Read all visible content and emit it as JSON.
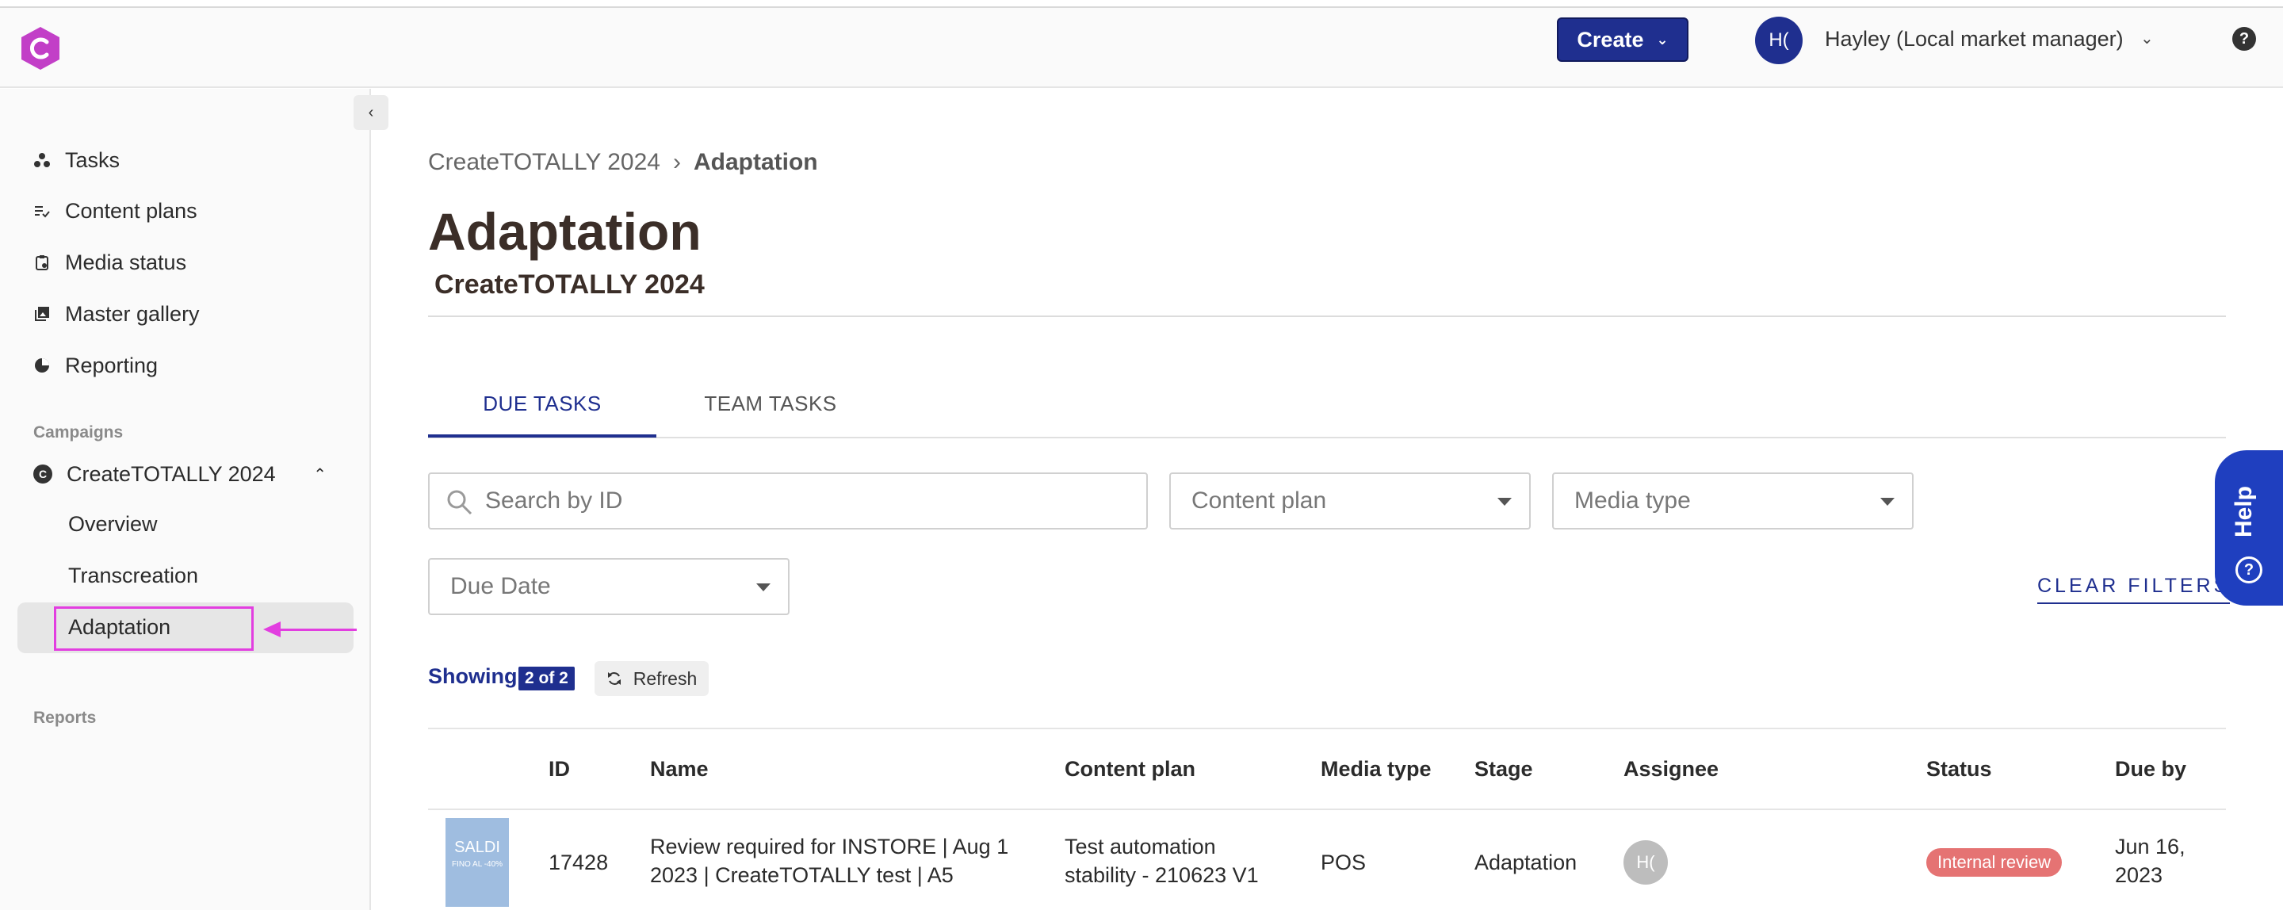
{
  "header": {
    "create_label": "Create",
    "user_initials": "H(",
    "user_name": "Hayley (Local market manager)"
  },
  "sidebar": {
    "items": [
      {
        "label": "Tasks",
        "icon": "tasks-icon"
      },
      {
        "label": "Content plans",
        "icon": "checklist-icon"
      },
      {
        "label": "Media status",
        "icon": "clipboard-icon"
      },
      {
        "label": "Master gallery",
        "icon": "gallery-icon"
      },
      {
        "label": "Reporting",
        "icon": "pie-chart-icon"
      }
    ],
    "campaigns_label": "Campaigns",
    "campaign": {
      "badge": "C",
      "name": "CreateTOTALLY 2024",
      "subitems": [
        "Overview",
        "Transcreation",
        "Adaptation"
      ]
    },
    "reports_label": "Reports"
  },
  "breadcrumb": {
    "parent": "CreateTOTALLY 2024",
    "separator": "›",
    "current": "Adaptation"
  },
  "page": {
    "title": "Adaptation",
    "subtitle": "CreateTOTALLY 2024"
  },
  "tabs": {
    "due": "DUE TASKS",
    "team": "TEAM TASKS"
  },
  "filters": {
    "search_placeholder": "Search by ID",
    "content_plan": "Content plan",
    "media_type": "Media type",
    "due_date": "Due Date",
    "clear": "CLEAR FILTERS"
  },
  "help_tab": {
    "label": "Help",
    "q": "?"
  },
  "results": {
    "showing_label": "Showing",
    "count": "2 of 2",
    "refresh_label": "Refresh"
  },
  "table": {
    "headers": {
      "id": "ID",
      "name": "Name",
      "content_plan": "Content plan",
      "media_type": "Media type",
      "stage": "Stage",
      "assignee": "Assignee",
      "status": "Status",
      "due_by": "Due by"
    },
    "rows": [
      {
        "thumb_title": "SALDI",
        "thumb_sub": "FINO AL -40%",
        "id": "17428",
        "name_line1": "Review required for INSTORE | Aug 1",
        "name_line2": "2023 | CreateTOTALLY test | A5",
        "plan_line1": "Test automation",
        "plan_line2": "stability - 210623 V1",
        "media_type": "POS",
        "stage": "Adaptation",
        "assignee_initials": "H(",
        "status": "Internal review",
        "due_line1": "Jun 16,",
        "due_line2": "2023"
      }
    ]
  },
  "colors": {
    "primary": "#1f2f8f",
    "help_tab": "#1f3fbf",
    "highlight": "#e23ee0",
    "status_badge": "#e57373",
    "logo": "#c23fc7"
  }
}
